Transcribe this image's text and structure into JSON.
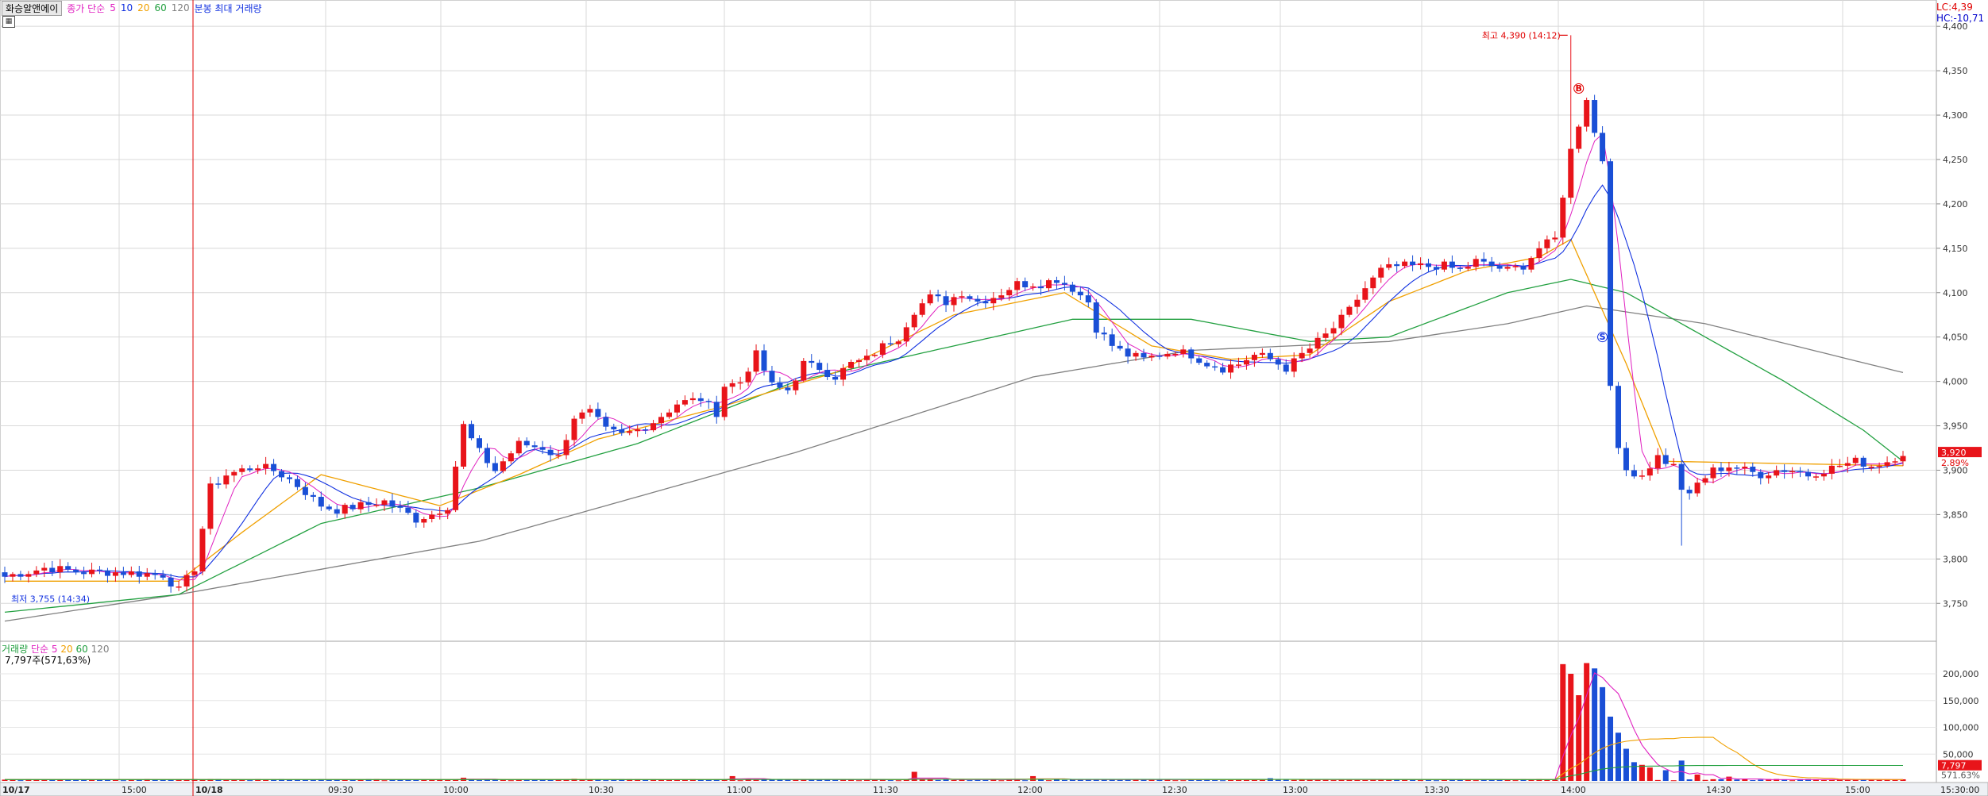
{
  "window": {
    "title": "화승알앤에이",
    "price_header": {
      "prefix": "종가 단순",
      "ma_labels": [
        "5",
        "10",
        "20",
        "60",
        "120"
      ],
      "extra": "분봉 최대 거래량"
    },
    "indicators": {
      "lc": "LC:4,39",
      "hc": "HC:-10,71"
    }
  },
  "colors": {
    "up": "#e8141a",
    "down": "#1a4fd6",
    "ma5": "#e020c0",
    "ma10": "#1030e0",
    "ma20": "#f0a000",
    "ma60": "#22a040",
    "ma120": "#808080",
    "grid": "#d8d8d8"
  },
  "chart_data": {
    "type": "candlestick",
    "price_axis": {
      "ticks": [
        "4,400",
        "4,350",
        "4,300",
        "4,250",
        "4,200",
        "4,150",
        "4,100",
        "4,050",
        "4,000",
        "3,950",
        "3,900",
        "3,850",
        "3,800",
        "3,750"
      ],
      "range": [
        3710,
        4410
      ]
    },
    "time_axis": {
      "labels": [
        "10/17",
        "15:00",
        "10/18",
        "09:30",
        "10:00",
        "10:30",
        "11:00",
        "11:30",
        "12:00",
        "12:30",
        "13:00",
        "13:30",
        "14:00",
        "14:30",
        "15:00",
        "15:30:00"
      ]
    },
    "annotations": {
      "high": "최고 4,390 (14:12)",
      "low": "최저 3,755 (14:34)",
      "buy_marker": "B",
      "sell_marker": "S"
    },
    "current": {
      "price": "3,920",
      "change": "2.89%"
    },
    "keypoints": [
      [
        0,
        3780
      ],
      [
        5,
        3790
      ],
      [
        10,
        3785
      ],
      [
        15,
        3785
      ],
      [
        20,
        3782
      ],
      [
        22,
        3765
      ],
      [
        24,
        3790
      ],
      [
        26,
        3880
      ],
      [
        28,
        3895
      ],
      [
        30,
        3900
      ],
      [
        32,
        3905
      ],
      [
        34,
        3900
      ],
      [
        36,
        3890
      ],
      [
        38,
        3875
      ],
      [
        40,
        3860
      ],
      [
        42,
        3855
      ],
      [
        45,
        3860
      ],
      [
        48,
        3865
      ],
      [
        50,
        3855
      ],
      [
        52,
        3845
      ],
      [
        54,
        3850
      ],
      [
        56,
        3860
      ],
      [
        58,
        3950
      ],
      [
        60,
        3920
      ],
      [
        62,
        3900
      ],
      [
        65,
        3930
      ],
      [
        68,
        3925
      ],
      [
        70,
        3915
      ],
      [
        72,
        3960
      ],
      [
        74,
        3965
      ],
      [
        76,
        3945
      ],
      [
        78,
        3940
      ],
      [
        80,
        3945
      ],
      [
        82,
        3955
      ],
      [
        85,
        3975
      ],
      [
        88,
        3980
      ],
      [
        90,
        3965
      ],
      [
        91,
        3995
      ],
      [
        93,
        4000
      ],
      [
        95,
        4030
      ],
      [
        97,
        3995
      ],
      [
        99,
        3990
      ],
      [
        101,
        4020
      ],
      [
        103,
        4015
      ],
      [
        105,
        4005
      ],
      [
        107,
        4020
      ],
      [
        109,
        4025
      ],
      [
        111,
        4040
      ],
      [
        113,
        4050
      ],
      [
        115,
        4080
      ],
      [
        117,
        4095
      ],
      [
        119,
        4090
      ],
      [
        121,
        4100
      ],
      [
        123,
        4090
      ],
      [
        125,
        4095
      ],
      [
        128,
        4110
      ],
      [
        131,
        4110
      ],
      [
        133,
        4115
      ],
      [
        135,
        4105
      ],
      [
        137,
        4090
      ],
      [
        138,
        4060
      ],
      [
        140,
        4040
      ],
      [
        142,
        4030
      ],
      [
        144,
        4025
      ],
      [
        146,
        4030
      ],
      [
        148,
        4035
      ],
      [
        150,
        4030
      ],
      [
        152,
        4020
      ],
      [
        154,
        4015
      ],
      [
        156,
        4020
      ],
      [
        158,
        4030
      ],
      [
        160,
        4025
      ],
      [
        162,
        4015
      ],
      [
        164,
        4030
      ],
      [
        166,
        4045
      ],
      [
        168,
        4060
      ],
      [
        170,
        4080
      ],
      [
        172,
        4105
      ],
      [
        174,
        4125
      ],
      [
        176,
        4130
      ],
      [
        178,
        4130
      ],
      [
        180,
        4130
      ],
      [
        182,
        4130
      ],
      [
        184,
        4125
      ],
      [
        186,
        4135
      ],
      [
        188,
        4130
      ],
      [
        190,
        4125
      ],
      [
        192,
        4130
      ],
      [
        194,
        4150
      ],
      [
        196,
        4160
      ],
      [
        197,
        4210
      ],
      [
        198,
        4260
      ],
      [
        200,
        4320
      ],
      [
        201,
        4280
      ],
      [
        202,
        4250
      ],
      [
        203,
        4000
      ],
      [
        204,
        3920
      ],
      [
        205,
        3900
      ],
      [
        207,
        3895
      ],
      [
        209,
        3915
      ],
      [
        211,
        3905
      ],
      [
        212,
        3880
      ],
      [
        213,
        3870
      ],
      [
        214,
        3885
      ],
      [
        216,
        3900
      ],
      [
        218,
        3905
      ],
      [
        220,
        3900
      ],
      [
        222,
        3895
      ],
      [
        224,
        3900
      ],
      [
        226,
        3900
      ],
      [
        228,
        3895
      ],
      [
        230,
        3900
      ],
      [
        232,
        3905
      ],
      [
        234,
        3910
      ],
      [
        236,
        3905
      ],
      [
        238,
        3910
      ],
      [
        240,
        3920
      ]
    ],
    "moving_averages": {
      "ma20": [
        [
          0,
          3775
        ],
        [
          22,
          3775
        ],
        [
          30,
          3830
        ],
        [
          40,
          3895
        ],
        [
          55,
          3860
        ],
        [
          65,
          3895
        ],
        [
          75,
          3935
        ],
        [
          90,
          3970
        ],
        [
          105,
          4010
        ],
        [
          120,
          4075
        ],
        [
          134,
          4100
        ],
        [
          145,
          4040
        ],
        [
          155,
          4025
        ],
        [
          165,
          4030
        ],
        [
          175,
          4090
        ],
        [
          185,
          4125
        ],
        [
          194,
          4140
        ],
        [
          198,
          4160
        ],
        [
          205,
          4020
        ],
        [
          210,
          3910
        ],
        [
          240,
          3905
        ]
      ],
      "ma60": [
        [
          0,
          3740
        ],
        [
          22,
          3760
        ],
        [
          40,
          3840
        ],
        [
          60,
          3880
        ],
        [
          80,
          3930
        ],
        [
          100,
          4000
        ],
        [
          120,
          4040
        ],
        [
          135,
          4070
        ],
        [
          150,
          4070
        ],
        [
          165,
          4045
        ],
        [
          175,
          4050
        ],
        [
          190,
          4100
        ],
        [
          198,
          4115
        ],
        [
          205,
          4100
        ],
        [
          215,
          4050
        ],
        [
          225,
          4000
        ],
        [
          235,
          3945
        ],
        [
          240,
          3910
        ]
      ],
      "ma120": [
        [
          0,
          3730
        ],
        [
          22,
          3760
        ],
        [
          60,
          3820
        ],
        [
          100,
          3920
        ],
        [
          130,
          4005
        ],
        [
          150,
          4035
        ],
        [
          175,
          4045
        ],
        [
          190,
          4065
        ],
        [
          200,
          4085
        ],
        [
          215,
          4065
        ],
        [
          240,
          4010
        ]
      ]
    },
    "volume": {
      "axis_ticks": [
        "200,000",
        "150,000",
        "100,000",
        "50,000"
      ],
      "range": [
        0,
        240000
      ],
      "spikes": [
        [
          58,
          6000
        ],
        [
          72,
          4000
        ],
        [
          92,
          9000
        ],
        [
          94,
          4000
        ],
        [
          115,
          17000
        ],
        [
          130,
          9000
        ],
        [
          160,
          5000
        ],
        [
          197,
          218000
        ],
        [
          198,
          200000
        ],
        [
          199,
          160000
        ],
        [
          200,
          220000
        ],
        [
          201,
          210000
        ],
        [
          202,
          175000
        ],
        [
          203,
          120000
        ],
        [
          204,
          90000
        ],
        [
          205,
          60000
        ],
        [
          206,
          35000
        ],
        [
          207,
          30000
        ],
        [
          208,
          25000
        ],
        [
          210,
          20000
        ],
        [
          212,
          38000
        ],
        [
          214,
          12000
        ],
        [
          218,
          8000
        ]
      ],
      "current": "7,797",
      "current_pct": "571.63%"
    }
  },
  "volume_panel": {
    "label": "거래량",
    "ma_prefix": "단순",
    "ma_labels": [
      "5",
      "20",
      "60",
      "120"
    ],
    "amount": "7,797주(571,63%)"
  }
}
